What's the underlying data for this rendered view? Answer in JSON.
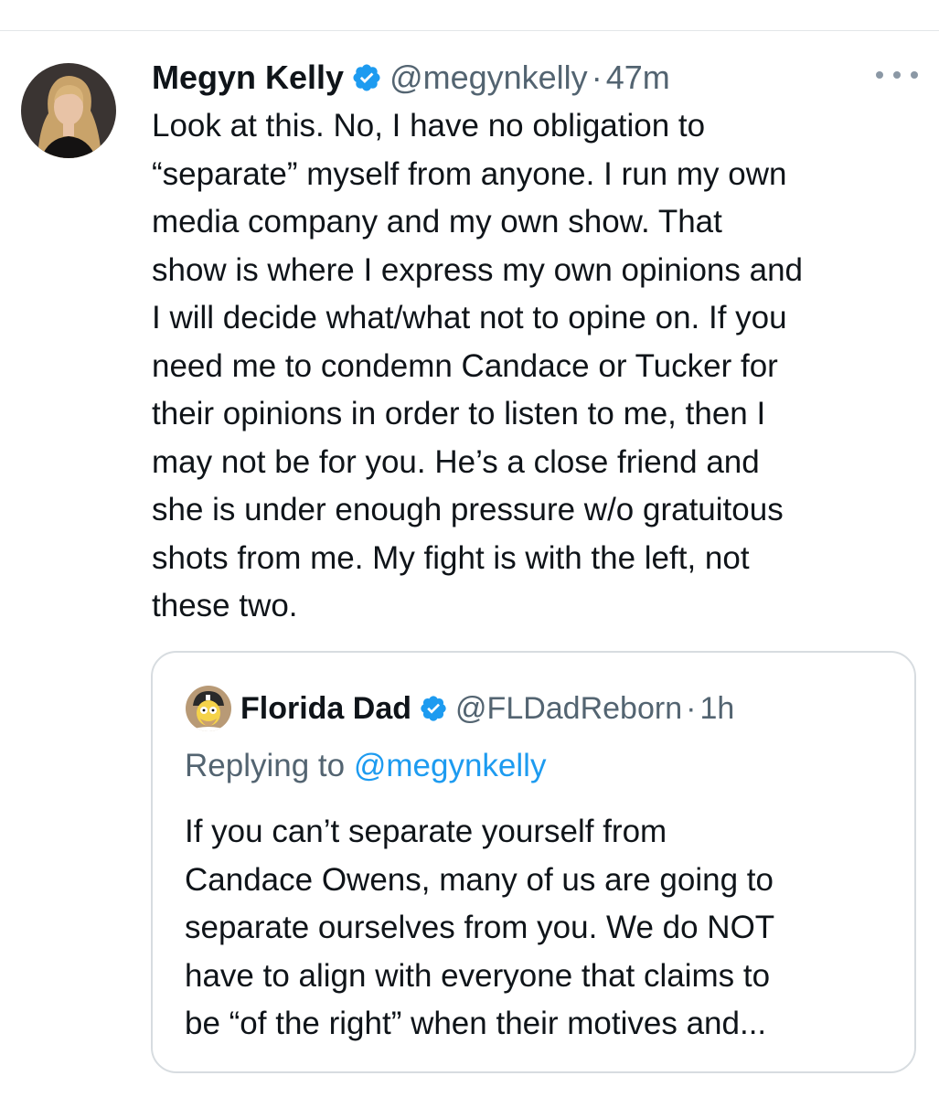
{
  "tweet": {
    "author_name": "Megyn Kelly",
    "handle": "@megynkelly",
    "separator": "·",
    "time": "47m",
    "verified_color": "#1d9bf0",
    "more_icon": "more-horizontal-icon",
    "body_lines": [
      "Look at this. No, I have no obligation to",
      "“separate” myself from anyone. I run my own",
      "media company and my own show. That",
      "show is where I express my own opinions and",
      "I will decide what/what not to opine on. If you",
      "need me to condemn Candace or Tucker for",
      "their opinions in order to listen to me, then I",
      "may not be for you. He’s a close friend and",
      "she is under enough pressure w/o gratuitous",
      "shots from me. My fight is with the left, not",
      "these two."
    ]
  },
  "quoted_tweet": {
    "author_name": "Florida Dad",
    "handle": "@FLDadReborn",
    "separator": "·",
    "time": "1h",
    "replying_to_label": "Replying to",
    "replying_to_handle": "@megynkelly",
    "body_lines": [
      "If you can’t separate yourself from",
      "Candace Owens, many of us are going to",
      "separate ourselves from you. We do NOT",
      "have to align with everyone that claims to",
      "be “of the right” when their motives and..."
    ]
  }
}
